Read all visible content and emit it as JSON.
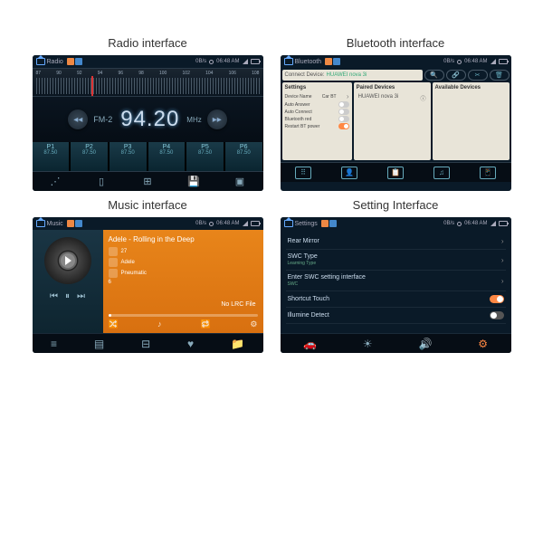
{
  "titles": {
    "radio": "Radio interface",
    "bluetooth": "Bluetooth interface",
    "music": "Music interface",
    "settings": "Setting Interface"
  },
  "status": {
    "speed": "0B/s",
    "time": "06:48 AM",
    "radio_app": "Radio",
    "bt_app": "Bluetooth",
    "music_app": "Music",
    "set_app": "Settings"
  },
  "radio": {
    "ticks": [
      "87",
      "90",
      "92",
      "94",
      "96",
      "98",
      "100",
      "102",
      "104",
      "106",
      "108"
    ],
    "band": "FM-2",
    "freq": "94.20",
    "unit": "MHz",
    "presets": [
      {
        "p": "P1",
        "f": "87.50"
      },
      {
        "p": "P2",
        "f": "87.50"
      },
      {
        "p": "P3",
        "f": "87.50"
      },
      {
        "p": "P4",
        "f": "87.50"
      },
      {
        "p": "P5",
        "f": "87.50"
      },
      {
        "p": "P6",
        "f": "87.50"
      }
    ]
  },
  "bt": {
    "connect_label": "Connect Device:",
    "device": "HUAWEI nova 3i",
    "settings_hdr": "Settings",
    "paired_hdr": "Paired Devices",
    "avail_hdr": "Available Devices",
    "rows": [
      {
        "l": "Device Name",
        "v": "Car BT"
      },
      {
        "l": "Auto Answer",
        "t": false
      },
      {
        "l": "Auto Connect",
        "t": false
      },
      {
        "l": "Bluetooth red",
        "t": false
      },
      {
        "l": "Restart BT power",
        "t": true
      }
    ],
    "paired": "HUAWEI nova 3i"
  },
  "music": {
    "track": "Adele - Rolling in the Deep",
    "idx": "27",
    "artist": "Adele",
    "album": "Pneumatic",
    "total": "6",
    "nolrc": "No LRC File"
  },
  "settings": {
    "rows": [
      {
        "l": "Rear Mirror",
        "sub": "",
        "t": null
      },
      {
        "l": "SWC Type",
        "sub": "Learning Type",
        "t": null
      },
      {
        "l": "Enter SWC setting interface",
        "sub": "SWC",
        "t": null
      },
      {
        "l": "Shortcut Touch",
        "sub": "",
        "t": true
      },
      {
        "l": "Illumine Detect",
        "sub": "",
        "t": false
      }
    ]
  }
}
